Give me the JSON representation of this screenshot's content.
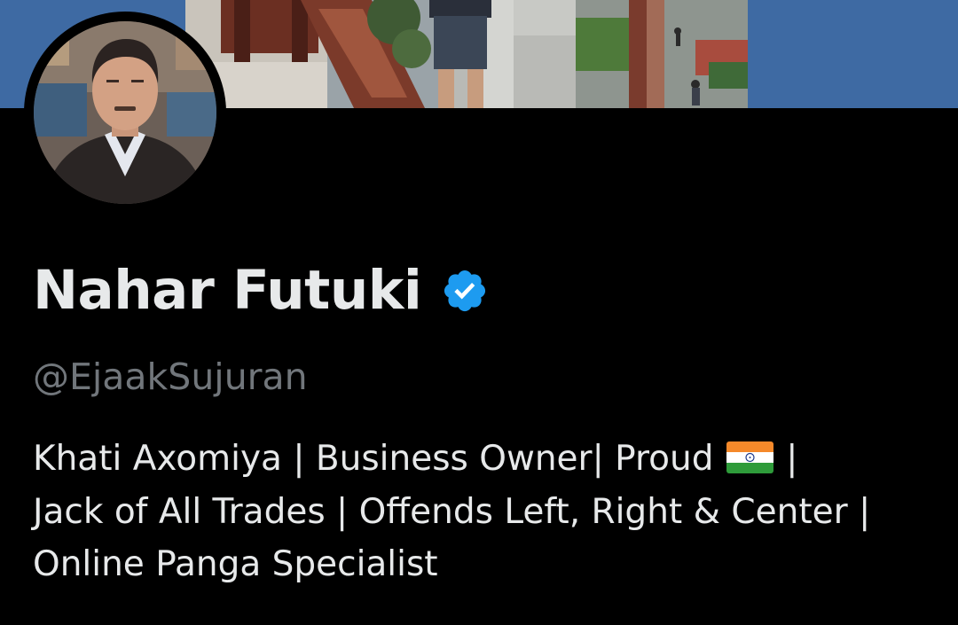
{
  "profile": {
    "display_name": "Nahar Futuki",
    "verified": true,
    "handle": "@EjaakSujuran",
    "bio": {
      "line1_a": "Khati Axomiya | Business Owner| Proud ",
      "flag": "india-flag",
      "line1_b": " |",
      "line2": "Jack of All Trades | Offends Left, Right & Center |",
      "line3": "Online Panga Specialist"
    }
  },
  "colors": {
    "background": "#000000",
    "banner": "#3e6aa3",
    "name_text": "#e7e9ea",
    "handle_text": "#71767b",
    "verified_blue": "#1d9bf0"
  },
  "icons": {
    "verified": "verified-badge-icon",
    "flag": "india-flag-icon"
  }
}
